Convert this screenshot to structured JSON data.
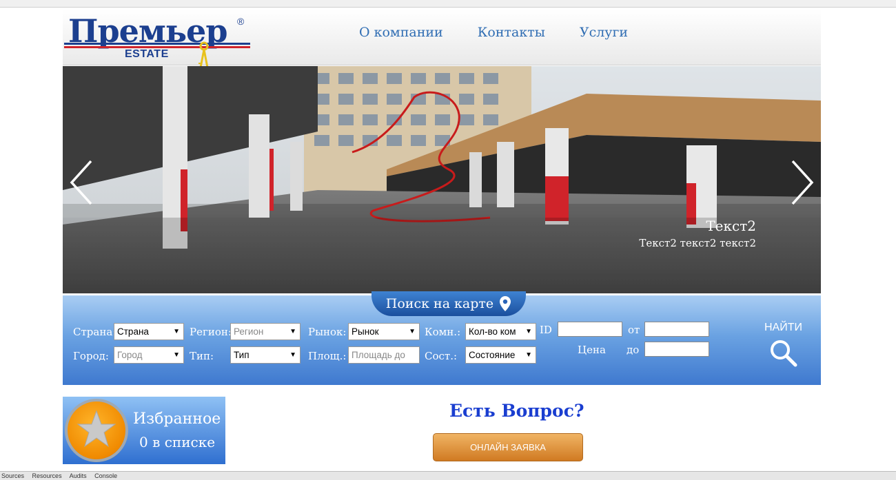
{
  "header": {
    "logo_text": "Премьер",
    "logo_reg": "®",
    "logo_sub": "ESTATE",
    "nav": [
      "О компании",
      "Контакты",
      "Услуги"
    ]
  },
  "slider": {
    "caption_title": "Текст2",
    "caption_sub": "Текст2 текст2 текст2"
  },
  "search": {
    "map_tab": "Поиск на карте",
    "country_label": "Страна:",
    "country_value": "Страна",
    "region_label": "Регион:",
    "region_value": "Регион",
    "market_label": "Рынок:",
    "market_value": "Рынок",
    "rooms_label": "Комн.:",
    "rooms_value": "Кол-во ком",
    "id_label": "ID",
    "from_label": "от",
    "city_label": "Город:",
    "city_value": "Город",
    "type_label": "Тип:",
    "type_value": "Тип",
    "area_label": "Площ.:",
    "area_placeholder": "Площадь до",
    "state_label": "Сост.:",
    "state_value": "Состояние",
    "price_label": "Цена",
    "to_label": "до",
    "find_label": "НАЙТИ"
  },
  "favorites": {
    "title": "Избранное",
    "count": "0 в списке"
  },
  "question": "Есть Вопрос?",
  "online_button": "ОНЛАЙН ЗАЯВКА",
  "devtools": [
    "Sources",
    "Resources",
    "Audits",
    "Console"
  ],
  "colors": {
    "brand_blue": "#1c3f8f",
    "nav_link": "#2f6db3",
    "question": "#1a3ed0",
    "button_orange": "#d07a22"
  }
}
